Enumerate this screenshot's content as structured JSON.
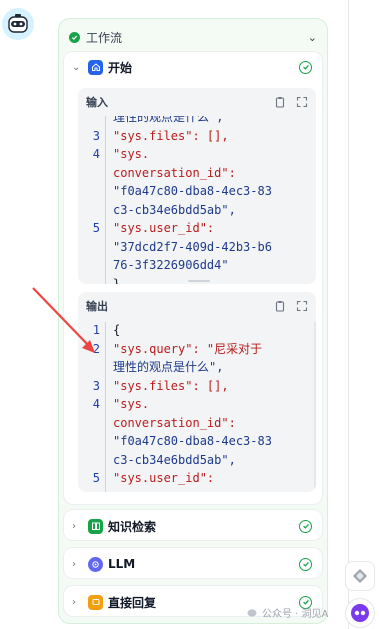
{
  "workflow": {
    "title": "工作流",
    "start_node": {
      "title": "开始",
      "input": {
        "label": "输入",
        "lines": [
          {
            "no": "",
            "text": "理性的观点是什么\","
          },
          {
            "no": "3",
            "text": "\"sys.files\": [],"
          },
          {
            "no": "4",
            "text": "\"sys."
          },
          {
            "no": "",
            "text": "conversation_id\":"
          },
          {
            "no": "",
            "text": "\"f0a47c80-dba8-4ec3-83"
          },
          {
            "no": "",
            "text": "c3-cb34e6bdd5ab\","
          },
          {
            "no": "5",
            "text": "\"sys.user_id\":"
          },
          {
            "no": "",
            "text": "\"37dcd2f7-409d-42b3-b6"
          },
          {
            "no": "",
            "text": "76-3f3226906dd4\""
          },
          {
            "no": "",
            "text": "}"
          }
        ]
      },
      "output": {
        "label": "输出",
        "lines": [
          {
            "no": "1",
            "text": "{"
          },
          {
            "no": "2",
            "text": "\"sys.query\": \"尼采对于"
          },
          {
            "no": "",
            "text": "理性的观点是什么\","
          },
          {
            "no": "3",
            "text": "\"sys.files\": [],"
          },
          {
            "no": "4",
            "text": "\"sys."
          },
          {
            "no": "",
            "text": "conversation_id\":"
          },
          {
            "no": "",
            "text": "\"f0a47c80-dba8-4ec3-83"
          },
          {
            "no": "",
            "text": "c3-cb34e6bdd5ab\","
          },
          {
            "no": "5",
            "text": "\"sys.user_id\":"
          }
        ]
      }
    },
    "nodes": [
      {
        "title": "知识检索",
        "icon": "book-icon",
        "color": "#16a34a"
      },
      {
        "title": "LLM",
        "icon": "llm-icon",
        "color": "#6366f1"
      },
      {
        "title": "直接回复",
        "icon": "reply-icon",
        "color": "#f59e0b"
      }
    ]
  },
  "watermark": {
    "text": "公众号 · 洞见A"
  },
  "colors": {
    "success": "#16a34a",
    "start_icon": "#2563eb",
    "arrow": "#ef4444"
  }
}
